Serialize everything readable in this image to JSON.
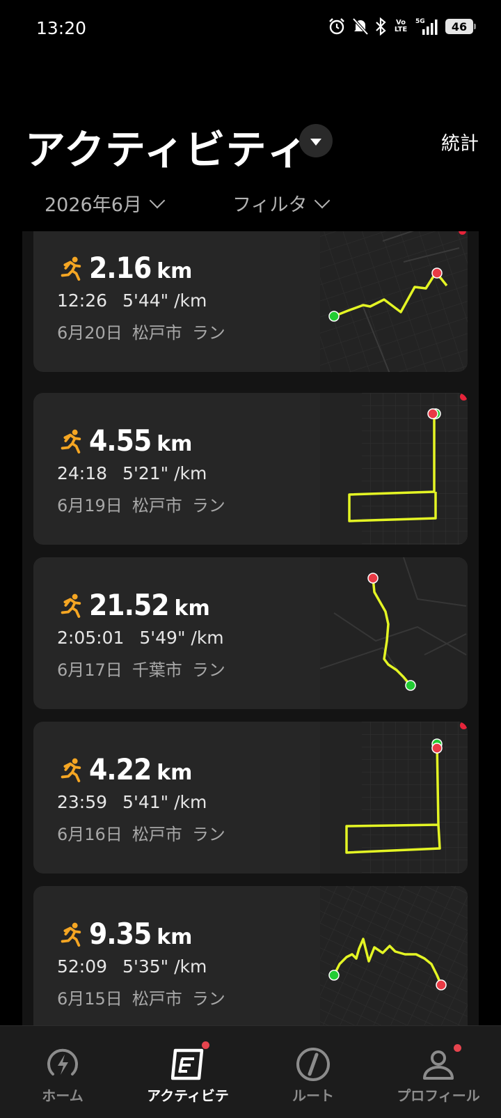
{
  "status_bar": {
    "time": "13:20",
    "lte_top": "Vo",
    "lte_bottom": "LTE",
    "network": "5G",
    "battery": "46"
  },
  "header": {
    "title": "アクティビテ​ィ",
    "stats_label": "統計",
    "month_filter": "2026年6月",
    "filter_label": "フィルタ"
  },
  "activities": [
    {
      "distance": "2.16",
      "unit": "km",
      "duration": "12:26",
      "pace": "5'44\" /km",
      "date": "6月20日",
      "place": "松戸市",
      "type": "ラン",
      "new": true
    },
    {
      "distance": "4.55",
      "unit": "km",
      "duration": "24:18",
      "pace": "5'21\" /km",
      "date": "6月19日",
      "place": "松戸市",
      "type": "ラン",
      "new": true
    },
    {
      "distance": "21.52",
      "unit": "km",
      "duration": "2:05:01",
      "pace": "5'49\" /km",
      "date": "6月17日",
      "place": "千葉市",
      "type": "ラン",
      "new": false
    },
    {
      "distance": "4.22",
      "unit": "km",
      "duration": "23:59",
      "pace": "5'41\" /km",
      "date": "6月16日",
      "place": "松戸市",
      "type": "ラン",
      "new": true
    },
    {
      "distance": "9.35",
      "unit": "km",
      "duration": "52:09",
      "pace": "5'35\" /km",
      "date": "6月15日",
      "place": "松戸市",
      "type": "ラン",
      "new": false
    }
  ],
  "nav": {
    "home": "ホーム",
    "activity": "アクティビテ",
    "route": "ルート",
    "profile": "プロフィール"
  },
  "colors": {
    "accent_route": "#e4f524",
    "run_icon": "#f5a623",
    "start_marker": "#22cc33",
    "end_marker": "#e83a45",
    "notification_dot": "#e6243a"
  }
}
